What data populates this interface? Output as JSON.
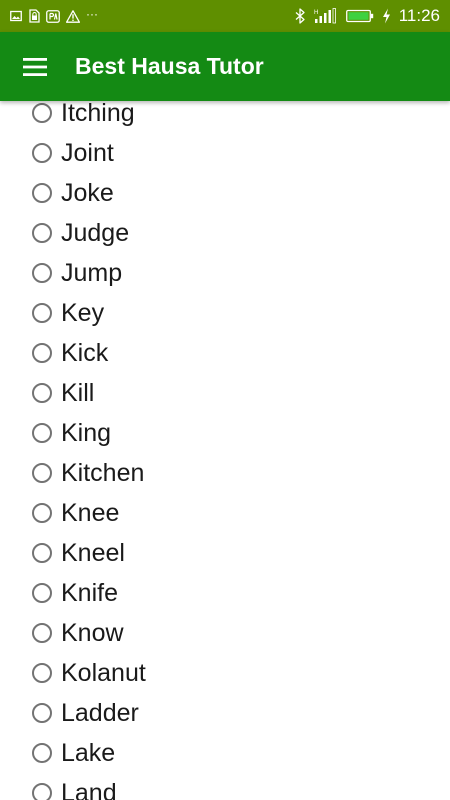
{
  "status_bar": {
    "left_icons": [
      "image-icon",
      "sim-lock-icon",
      "pay-icon",
      "warning-icon"
    ],
    "overflow": "···",
    "right_icons": [
      "bluetooth-icon",
      "signal-icon",
      "battery-icon",
      "charging-icon"
    ],
    "time": "11:26",
    "color": "#5f8f00"
  },
  "app_bar": {
    "title": "Best Hausa Tutor",
    "menu_icon": "hamburger-menu-icon",
    "color": "#148a14"
  },
  "word_list": {
    "items": [
      "Itching",
      "Joint",
      "Joke",
      "Judge",
      "Jump",
      "Key",
      "Kick",
      "Kill",
      "King",
      "Kitchen",
      "Knee",
      "Kneel",
      "Knife",
      "Know",
      "Kolanut",
      "Ladder",
      "Lake",
      "Land"
    ]
  }
}
